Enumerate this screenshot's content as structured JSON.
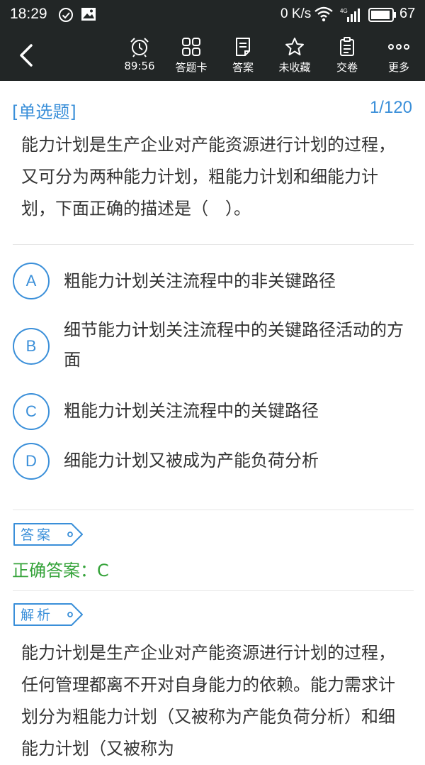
{
  "status_bar": {
    "time": "18:29",
    "net_speed": "0 K/s",
    "battery": "67"
  },
  "toolbar": {
    "items": [
      {
        "icon": "alarm-clock-icon",
        "label": "89:56"
      },
      {
        "icon": "grid-icon",
        "label": "答题卡"
      },
      {
        "icon": "document-icon",
        "label": "答案"
      },
      {
        "icon": "star-icon",
        "label": "未收藏"
      },
      {
        "icon": "clipboard-icon",
        "label": "交卷"
      },
      {
        "icon": "more-dots-icon",
        "label": "更多"
      }
    ]
  },
  "question": {
    "type": "[单选题]",
    "counter": "1/120",
    "text": "能力计划是生产企业对产能资源进行计划的过程，又可分为两种能力计划，粗能力计划和细能力计划，下面正确的描述是（　）。",
    "options": [
      {
        "letter": "A",
        "text": "粗能力计划关注流程中的非关键路径"
      },
      {
        "letter": "B",
        "text": "细节能力计划关注流程中的关键路径活动的方面"
      },
      {
        "letter": "C",
        "text": "粗能力计划关注流程中的关键路径"
      },
      {
        "letter": "D",
        "text": "细能力计划又被成为产能负荷分析"
      }
    ]
  },
  "answer": {
    "tag": "答案",
    "correct": "正确答案：C"
  },
  "analysis": {
    "tag": "解析",
    "text": "能力计划是生产企业对产能资源进行计划的过程，任何管理都离不开对自身能力的依赖。能力需求计划分为粗能力计划（又被称为产能负荷分析）和细能力计划（又被称为"
  },
  "colors": {
    "bar_bg": "#222626",
    "accent_blue": "#3a8fd9",
    "correct_green": "#35a33a"
  }
}
